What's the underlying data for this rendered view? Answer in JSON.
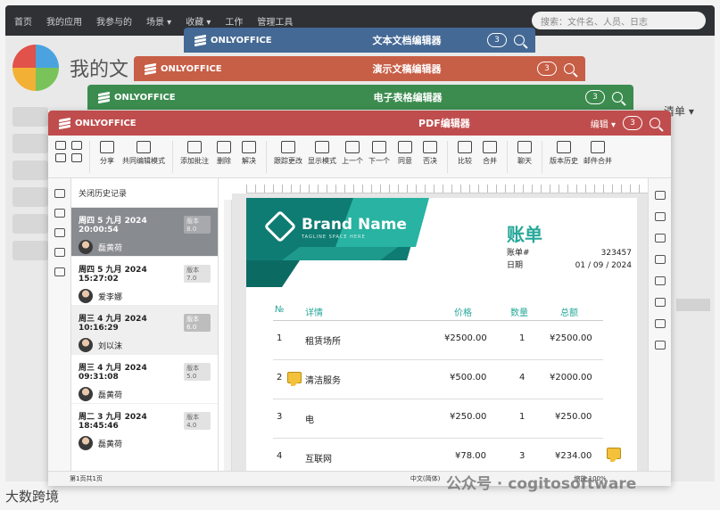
{
  "bg_menu": [
    "首页",
    "我的应用",
    "我参与的",
    "场景 ▾",
    "收藏 ▾",
    "工作",
    "管理工具"
  ],
  "bg_search": "搜索：文件名、人员、日志",
  "bg_title": "我的文",
  "bg_right": "清单 ▾",
  "windows": [
    {
      "logo": "ONLYOFFICE",
      "title": "文本文档编辑器",
      "users": "3",
      "color": "#446995"
    },
    {
      "logo": "ONLYOFFICE",
      "title": "演示文稿编辑器",
      "users": "3",
      "color": "#c75e46"
    },
    {
      "logo": "ONLYOFFICE",
      "title": "电子表格编辑器",
      "users": "3",
      "color": "#3c8c4f"
    },
    {
      "logo": "ONLYOFFICE",
      "title": "PDF编辑器",
      "users": "3",
      "edit": "编辑 ▾",
      "color": "#c04d4d"
    }
  ],
  "toolbar": {
    "share": "分享",
    "coedit": "共同编辑模式",
    "add_comment": "添加批注",
    "delete": "删除",
    "resolve": "解决",
    "track": "跟踪更改",
    "display": "显示模式",
    "prev": "上一个",
    "next": "下一个",
    "accept": "同意",
    "reject": "否决",
    "compare": "比较",
    "merge": "合并",
    "chat": "聊天",
    "history": "版本历史",
    "mailmerge": "邮件合并"
  },
  "history": {
    "close": "关闭历史记录",
    "items": [
      {
        "date": "周四 5 九月 2024 20:00:54",
        "ver": "版本8.0",
        "user": "磊黄荷"
      },
      {
        "date": "周四 5 九月 2024 15:27:02",
        "ver": "版本7.0",
        "user": "爱李娜"
      },
      {
        "date": "周三 4 九月 2024 10:16:29",
        "ver": "版本6.0",
        "user": "刘以沫"
      },
      {
        "date": "周三 4 九月 2024 09:31:08",
        "ver": "版本5.0",
        "user": "磊黄荷"
      },
      {
        "date": "周二 3 九月 2024 18:45:46",
        "ver": "版本4.0",
        "user": "磊黄荷"
      }
    ]
  },
  "invoice": {
    "brand": "Brand Name",
    "tagline": "TAGLINE SPACE HERE",
    "title": "账单",
    "acct_label": "账单#",
    "acct": "323457",
    "date_label": "日期",
    "date": "01 / 09 / 2024",
    "headers": {
      "no": "№",
      "detail": "详情",
      "price": "价格",
      "qty": "数量",
      "total": "总额"
    },
    "rows": [
      {
        "no": "1",
        "detail": "租赁场所",
        "price": "¥2500.00",
        "qty": "1",
        "total": "¥2500.00"
      },
      {
        "no": "2",
        "detail": "清洁服务",
        "price": "¥500.00",
        "qty": "4",
        "total": "¥2000.00"
      },
      {
        "no": "3",
        "detail": "电",
        "price": "¥250.00",
        "qty": "1",
        "total": "¥250.00"
      },
      {
        "no": "4",
        "detail": "互联网",
        "price": "¥78.00",
        "qty": "3",
        "total": "¥234.00"
      }
    ]
  },
  "status": {
    "page": "第1页共1页",
    "lang": "中文(简体)",
    "zoom": "缩放 100%"
  },
  "watermark": "公众号 · cogitosoftware",
  "watermark2": "大数跨境"
}
